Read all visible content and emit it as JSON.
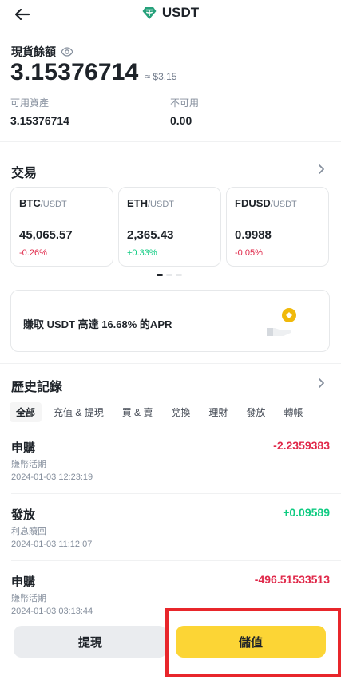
{
  "header": {
    "title": "USDT",
    "back_icon": "arrow-left-icon",
    "coin_icon": "tether-icon",
    "coin_color": "#26a17b"
  },
  "balance": {
    "label": "現貨餘額",
    "eye_icon": "eye-icon",
    "value": "3.15376714",
    "fiat": "≈ $3.15"
  },
  "stats": {
    "available_label": "可用資產",
    "available_value": "3.15376714",
    "unavailable_label": "不可用",
    "unavailable_value": "0.00"
  },
  "trade": {
    "title": "交易",
    "pairs": [
      {
        "base": "BTC",
        "quote": "/USDT",
        "price": "45,065.57",
        "change": "-0.26%"
      },
      {
        "base": "ETH",
        "quote": "/USDT",
        "price": "2,365.43",
        "change": "+0.33%"
      },
      {
        "base": "FDUSD",
        "quote": "/USDT",
        "price": "0.9988",
        "change": "-0.05%"
      }
    ]
  },
  "promo": {
    "text": "賺取 USDT 高達 16.68% 的APR"
  },
  "history": {
    "title": "歷史記錄",
    "tabs": [
      "全部",
      "充值 & 提現",
      "買 & 賣",
      "兌換",
      "理財",
      "發放",
      "轉帳"
    ],
    "active_tab": "全部",
    "transactions": [
      {
        "type": "申購",
        "sub": "賺幣活期",
        "time": "2024-01-03 12:23:19",
        "amount": "-2.2359383"
      },
      {
        "type": "發放",
        "sub": "利息贖回",
        "time": "2024-01-03 11:12:07",
        "amount": "+0.09589"
      },
      {
        "type": "申購",
        "sub": "賺幣活期",
        "time": "2024-01-03 03:13:44",
        "amount": "-496.51533513"
      }
    ]
  },
  "actions": {
    "withdraw_label": "提現",
    "deposit_label": "儲值"
  },
  "colors": {
    "accent": "#fcd535",
    "negative": "#e0294a",
    "positive": "#0ecb81",
    "highlight": "#e8262b"
  }
}
